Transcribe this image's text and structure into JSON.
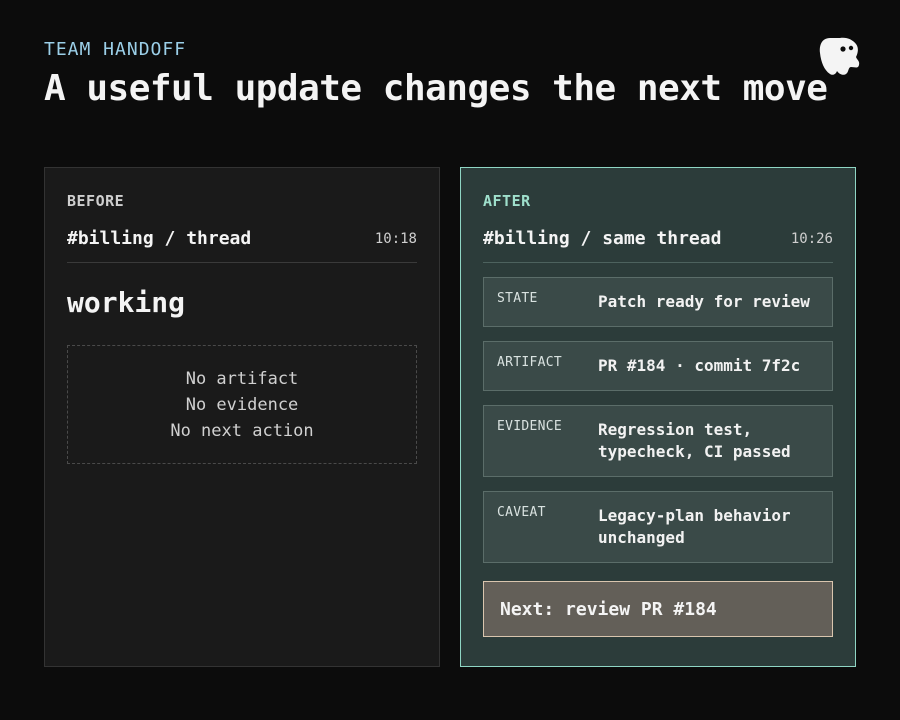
{
  "header": {
    "eyebrow": "TEAM HANDOFF",
    "title": "A useful update changes the next move"
  },
  "logo": {
    "icon": "ghost-mascot-icon"
  },
  "before": {
    "label": "BEFORE",
    "thread": "#billing / thread",
    "time": "10:18",
    "status": "working",
    "empty_lines": [
      "No artifact",
      "No evidence",
      "No next action"
    ]
  },
  "after": {
    "label": "AFTER",
    "thread": "#billing / same thread",
    "time": "10:26",
    "fields": [
      {
        "key": "STATE",
        "value": "Patch ready for review"
      },
      {
        "key": "ARTIFACT",
        "value": "PR #184 · commit 7f2c"
      },
      {
        "key": "EVIDENCE",
        "value": "Regression test, typecheck, CI passed"
      },
      {
        "key": "CAVEAT",
        "value": "Legacy-plan behavior unchanged"
      }
    ],
    "next": "Next: review PR #184"
  },
  "colors": {
    "background": "#0c0c0c",
    "eyebrow": "#9bcfe8",
    "after_border": "#8fd6c4",
    "after_label": "#9fe0cc",
    "next_border": "#d9c5ae"
  }
}
